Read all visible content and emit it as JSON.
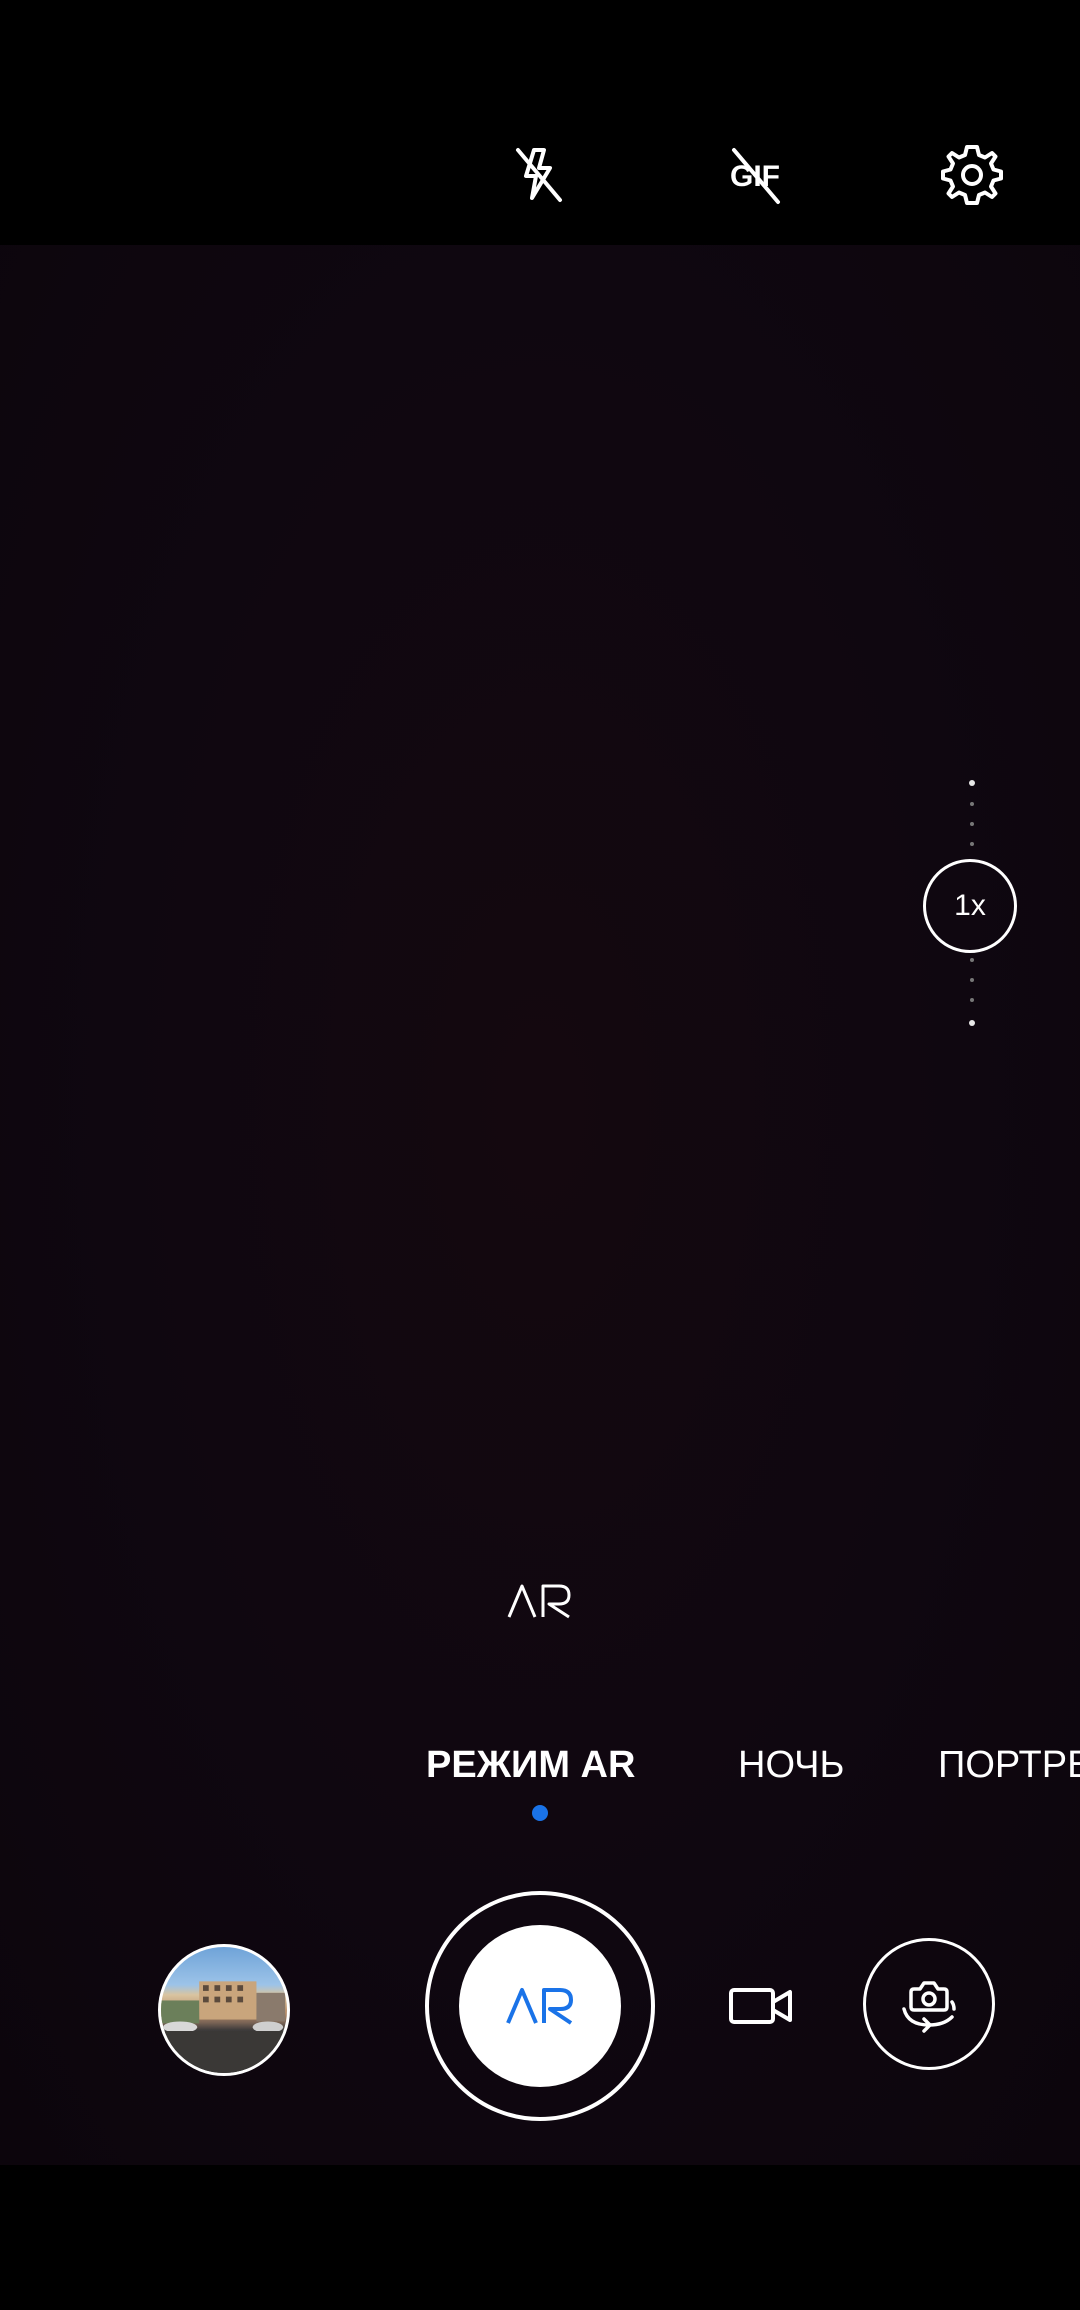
{
  "toolbar": {
    "flash_icon": "flash-off-icon",
    "gif_label": "GIF",
    "gif_icon": "gif-off-icon",
    "settings_icon": "gear-icon"
  },
  "zoom": {
    "level_label": "1x"
  },
  "ar_badge": {
    "icon": "ar-logo-icon"
  },
  "modes": {
    "items": [
      {
        "label": "РЕЖИМ AR",
        "active": true
      },
      {
        "label": "НОЧЬ",
        "active": false
      },
      {
        "label": "ПОРТРЕТ",
        "active": false
      }
    ],
    "indicator_color": "#1a73e8"
  },
  "controls": {
    "gallery_icon": "gallery-thumbnail",
    "shutter_icon": "ar-logo-icon",
    "shutter_accent": "#1a73e8",
    "video_icon": "video-camera-icon",
    "switch_icon": "camera-switch-icon"
  }
}
